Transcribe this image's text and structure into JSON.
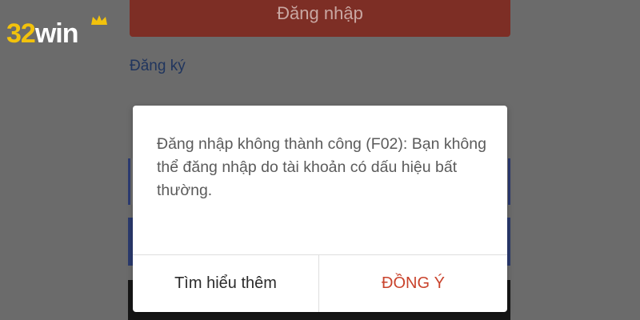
{
  "logo": {
    "number": "32",
    "word": "win"
  },
  "background": {
    "login_button_label": "Đăng nhập",
    "register_link_label": "Đăng ký"
  },
  "dialog": {
    "message": "Đăng nhập không thành công (F02): Bạn không thể đăng nhập do tài khoản có dấu hiệu bất thường.",
    "secondary_button_label": "Tìm hiểu thêm",
    "primary_button_label": "ĐỒNG Ý"
  },
  "colors": {
    "overlay": "#6b6b6b",
    "logo_number": "#f2c20c",
    "primary_action": "#c9432c",
    "dialog_background": "#ffffff"
  },
  "icons": [
    "crown-icon"
  ]
}
